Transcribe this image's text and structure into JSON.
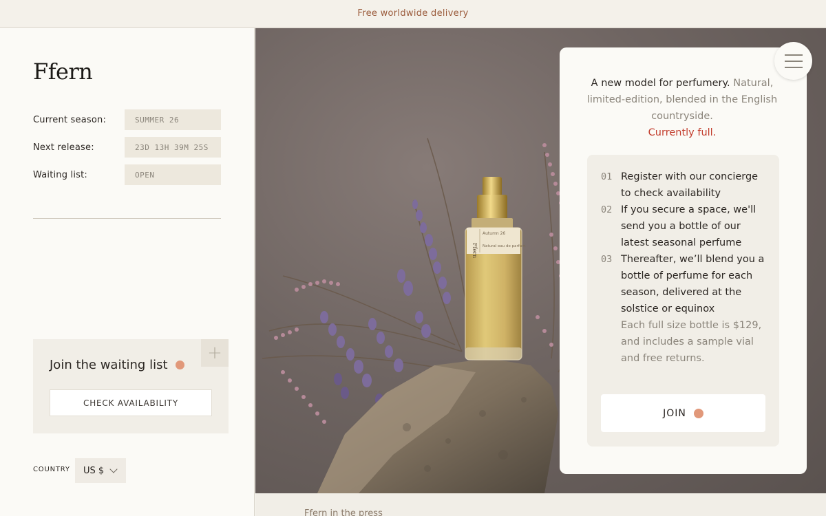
{
  "announcement": "Free worldwide delivery",
  "brand": "Ffern",
  "season_info": [
    {
      "label": "Current season:",
      "value": "SUMMER  26"
    },
    {
      "label": "Next release:",
      "value": "23D 13H 39M 25S"
    },
    {
      "label": "Waiting list:",
      "value": "OPEN"
    }
  ],
  "waitlist": {
    "title": "Join the waiting list",
    "check_label": "CHECK AVAILABILITY",
    "expand_icon": "plus-icon"
  },
  "country": {
    "label": "COUNTRY",
    "selected": "US $"
  },
  "hero": {
    "bottle_label_line1": "Autumn 26",
    "bottle_label_line2": "Natural eau de parfum",
    "bottle_brand": "Ffern"
  },
  "card": {
    "intro_dark": "A new model for perfumery.",
    "intro_light": " Natural, limited-edition, blended in the English countryside.",
    "status": "Currently full.",
    "steps": [
      {
        "num": "01",
        "text": "Register with our concierge to check availability"
      },
      {
        "num": "02",
        "text": "If you secure a space, we'll send you a bottle of our latest seasonal perfume"
      },
      {
        "num": "03",
        "text": "Thereafter, we’ll blend you a bottle of perfume for each season, delivered at the solstice or equinox"
      }
    ],
    "note": "Each full size bottle is $129, and includes a sample vial and free returns.",
    "join_label": "JOIN"
  },
  "press_text": "Ffern in the press",
  "colors": {
    "accent_dot": "#e1987a",
    "status_red": "#c23b2b",
    "announcement": "#9a5a3a"
  }
}
